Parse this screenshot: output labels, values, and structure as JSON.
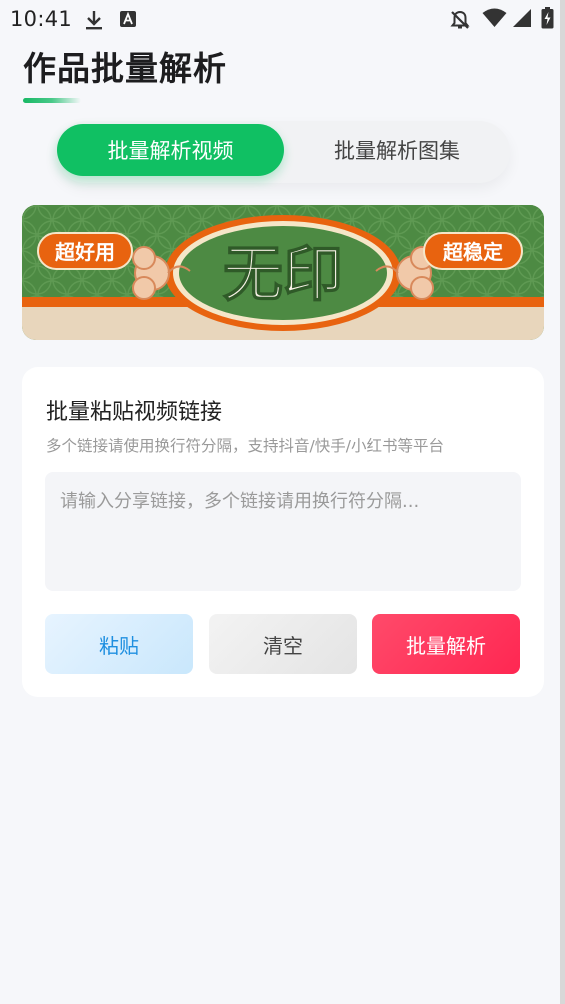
{
  "status_bar": {
    "time": "10:41",
    "icons": [
      "download-icon",
      "a-badge-icon",
      "notifications-off-icon",
      "wifi-icon",
      "signal-icon",
      "battery-charging-icon"
    ]
  },
  "header": {
    "title": "作品批量解析",
    "accent_color": "#10c063"
  },
  "tabs": [
    {
      "label": "批量解析视频",
      "active": true
    },
    {
      "label": "批量解析图集",
      "active": false
    }
  ],
  "banner": {
    "left_badge": "超好用",
    "center_text": "无印",
    "right_badge": "超稳定",
    "colors": {
      "green": "#4d8a43",
      "orange": "#e8630f",
      "cream": "#e8d6bc"
    }
  },
  "paste_card": {
    "title": "批量粘贴视频链接",
    "hint": "多个链接请使用换行符分隔，支持抖音/快手/小红书等平台",
    "input_value": "",
    "input_placeholder": "请输入分享链接，多个链接请用换行符分隔...",
    "buttons": {
      "paste": "粘贴",
      "clear": "清空",
      "parse": "批量解析"
    }
  }
}
